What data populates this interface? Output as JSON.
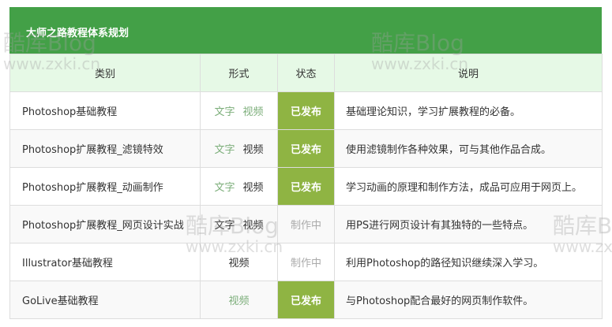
{
  "header": {
    "title": "大师之路教程体系规划"
  },
  "columns": [
    "类别",
    "形式",
    "状态",
    "说明"
  ],
  "rows": [
    {
      "category": "Photoshop基础教程",
      "text_label": "文字",
      "text_color": "green",
      "video_label": "视频",
      "video_color": "green",
      "status": "已发布",
      "status_type": "published",
      "description": "基础理论知识，学习扩展教程的必备。"
    },
    {
      "category": "Photoshop扩展教程_滤镜特效",
      "text_label": "文字",
      "text_color": "green",
      "video_label": "视频",
      "video_color": "dark",
      "status": "已发布",
      "status_type": "published",
      "description": "使用滤镜制作各种效果，可与其他作品合成。"
    },
    {
      "category": "Photoshop扩展教程_动画制作",
      "text_label": "文字",
      "text_color": "green",
      "video_label": "视频",
      "video_color": "dark",
      "status": "已发布",
      "status_type": "published",
      "description": "学习动画的原理和制作方法，成品可应用于网页上。"
    },
    {
      "category": "Photoshop扩展教程_网页设计实战",
      "text_label": "文字",
      "text_color": "dark",
      "video_label": "视频",
      "video_color": "dark",
      "status": "制作中",
      "status_type": "making",
      "description": "用PS进行网页设计有其独特的一些特点。"
    },
    {
      "category": "Illustrator基础教程",
      "text_label": "",
      "text_color": "dark",
      "video_label": "视频",
      "video_color": "dark",
      "status": "制作中",
      "status_type": "making",
      "description": "利用Photoshop的路径知识继续深入学习。"
    },
    {
      "category": "GoLive基础教程",
      "text_label": "",
      "text_color": "green",
      "video_label": "视频",
      "video_color": "green",
      "status": "已发布",
      "status_type": "published",
      "description": "与Photoshop配合最好的网页制作软件。"
    }
  ],
  "watermark": {
    "brand": "酷库Blog",
    "url": "www.zxki.cn"
  },
  "colors": {
    "header": "#43a047",
    "thead": "#e6f9e6",
    "published": "#8fb443",
    "green_text": "#7cae7a"
  }
}
